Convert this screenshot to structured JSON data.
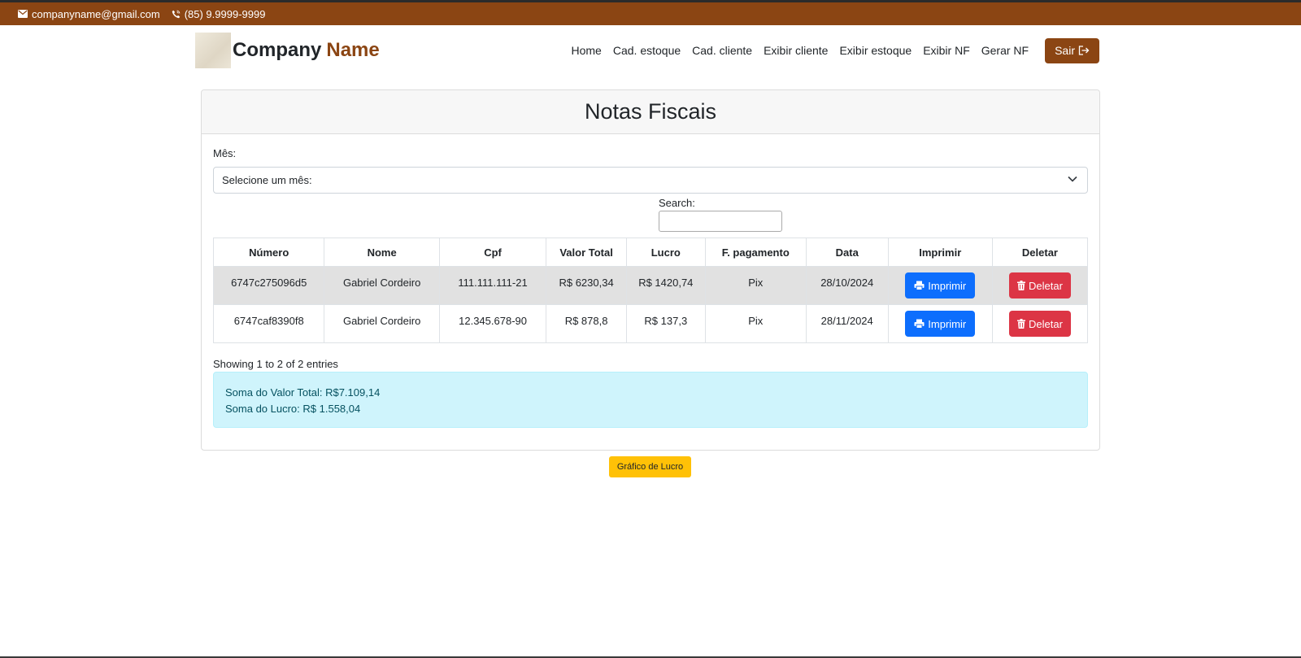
{
  "topbar": {
    "email": "companyname@gmail.com",
    "phone": "(85) 9.9999-9999",
    "bg_color": "#8b4513"
  },
  "brand": {
    "name_part1": "Company",
    "name_part2": "Name",
    "accent_color": "#8b4513"
  },
  "nav": {
    "links": [
      "Home",
      "Cad. estoque",
      "Cad. cliente",
      "Exibir cliente",
      "Exibir estoque",
      "Exibir NF",
      "Gerar NF"
    ],
    "logout_label": "Sair"
  },
  "card": {
    "title": "Notas Fiscais",
    "month_label": "Mês:",
    "month_select_value": "Selecione um mês:",
    "search_label": "Search:",
    "search_value": ""
  },
  "table": {
    "headers": [
      "Número",
      "Nome",
      "Cpf",
      "Valor Total",
      "Lucro",
      "F. pagamento",
      "Data",
      "Imprimir",
      "Deletar"
    ],
    "rows": [
      {
        "numero": "6747c275096d5",
        "nome": "Gabriel Cordeiro",
        "cpf": "111.111.111-21",
        "valor_total": "R$ 6230,34",
        "lucro": "R$ 1420,74",
        "pagamento": "Pix",
        "data": "28/10/2024",
        "print_label": "Imprimir",
        "delete_label": "Deletar"
      },
      {
        "numero": "6747caf8390f8",
        "nome": "Gabriel Cordeiro",
        "cpf": "12.345.678-90",
        "valor_total": "R$ 878,8",
        "lucro": "R$ 137,3",
        "pagamento": "Pix",
        "data": "28/11/2024",
        "print_label": "Imprimir",
        "delete_label": "Deletar"
      }
    ]
  },
  "entries_info": "Showing 1 to 2 of 2 entries",
  "summary": {
    "valor_total": "Soma do Valor Total: R$7.109,14",
    "lucro": "Soma do Lucro: R$ 1.558,04"
  },
  "chart_button_label": "Gráfico de Lucro",
  "icons": {
    "email": "envelope-icon",
    "phone": "phone-icon",
    "logout": "logout-icon",
    "print": "printer-icon",
    "delete": "trash-icon",
    "select": "chevron-down-icon"
  }
}
